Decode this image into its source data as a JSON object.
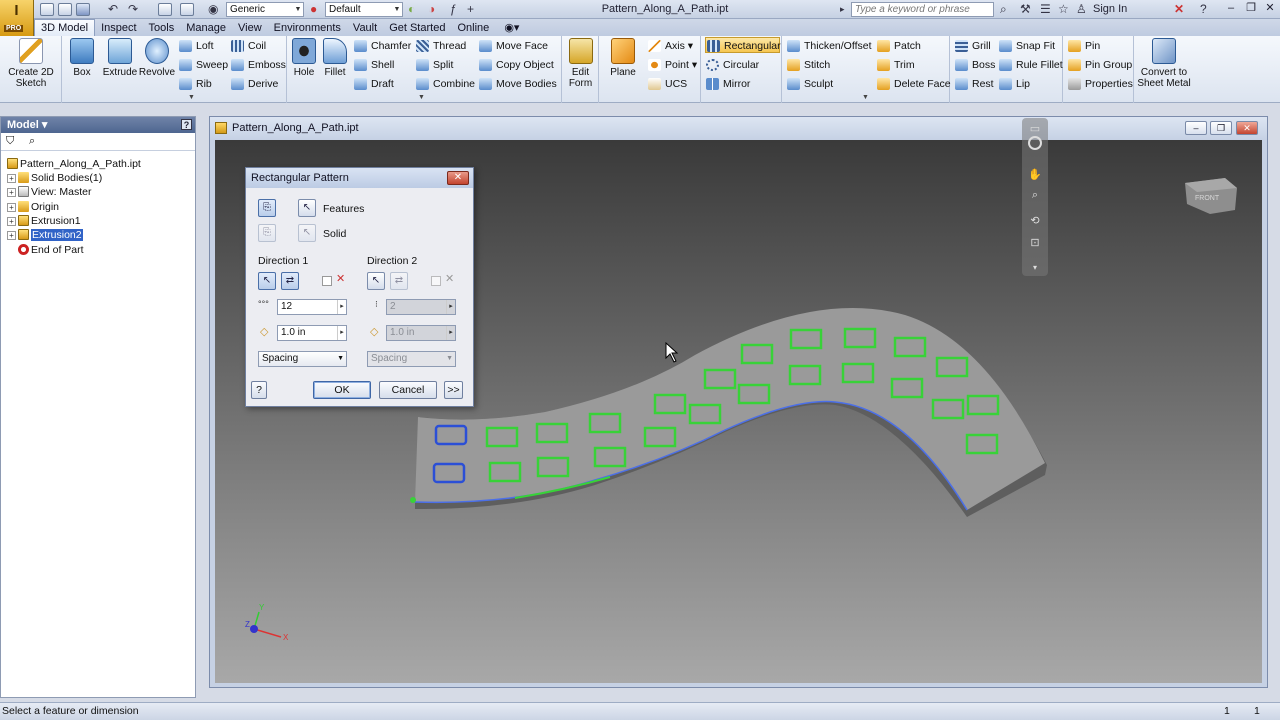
{
  "app": {
    "badge": "I",
    "badge_sub": "PRO",
    "document_title": "Pattern_Along_A_Path.ipt",
    "appearance": "Generic",
    "material": "Default",
    "search_placeholder": "Type a keyword or phrase",
    "sign_in": "Sign In"
  },
  "tabs": [
    "3D Model",
    "Inspect",
    "Tools",
    "Manage",
    "View",
    "Environments",
    "Vault",
    "Get Started",
    "Online"
  ],
  "ribbon": {
    "create_2d_sketch": "Create 2D Sketch",
    "box": "Box",
    "extrude": "Extrude",
    "revolve": "Revolve",
    "loft": "Loft",
    "sweep": "Sweep",
    "rib": "Rib",
    "coil": "Coil",
    "emboss": "Emboss",
    "derive": "Derive",
    "hole": "Hole",
    "fillet": "Fillet",
    "chamfer": "Chamfer",
    "shell": "Shell",
    "draft": "Draft",
    "thread": "Thread",
    "split": "Split",
    "combine": "Combine",
    "move_face": "Move Face",
    "copy_object": "Copy Object",
    "move_bodies": "Move Bodies",
    "edit_form": "Edit Form",
    "plane": "Plane",
    "axis": "Axis",
    "point": "Point",
    "ucs": "UCS",
    "rectangular": "Rectangular",
    "circular": "Circular",
    "mirror": "Mirror",
    "thicken_offset": "Thicken/Offset",
    "stitch": "Stitch",
    "sculpt": "Sculpt",
    "patch": "Patch",
    "trim": "Trim",
    "delete_face": "Delete Face",
    "grill": "Grill",
    "boss": "Boss",
    "rest": "Rest",
    "snap_fit": "Snap Fit",
    "rule_fillet": "Rule Fillet",
    "lip": "Lip",
    "pin": "Pin",
    "pin_group": "Pin Group",
    "properties": "Properties",
    "convert_sheet_metal": "Convert to Sheet Metal"
  },
  "browser": {
    "title": "Model",
    "items": [
      {
        "label": "Pattern_Along_A_Path.ipt"
      },
      {
        "label": "Solid Bodies(1)"
      },
      {
        "label": "View: Master"
      },
      {
        "label": "Origin"
      },
      {
        "label": "Extrusion1"
      },
      {
        "label": "Extrusion2"
      },
      {
        "label": "End of Part"
      }
    ]
  },
  "graphics": {
    "title": "Pattern_Along_A_Path.ipt",
    "viewcube_label": "FRONT",
    "axis_x": "X",
    "axis_y": "Y",
    "axis_z": "Z"
  },
  "dialog": {
    "title": "Rectangular Pattern",
    "features_label": "Features",
    "solid_label": "Solid",
    "direction1_label": "Direction 1",
    "direction2_label": "Direction 2",
    "d1_count": "12",
    "d1_length": "1.0 in",
    "d1_method": "Spacing",
    "d2_count": "2",
    "d2_length": "1.0 in",
    "d2_method": "Spacing",
    "ok": "OK",
    "cancel": "Cancel",
    "more": ">>",
    "help": "?"
  },
  "status": {
    "message": "Select a feature or dimension",
    "count1": "1",
    "count2": "1"
  },
  "colors": {
    "pattern_green": "#38d238",
    "selected_blue": "#2b4fd6",
    "part_gray": "#9a9a9a"
  }
}
